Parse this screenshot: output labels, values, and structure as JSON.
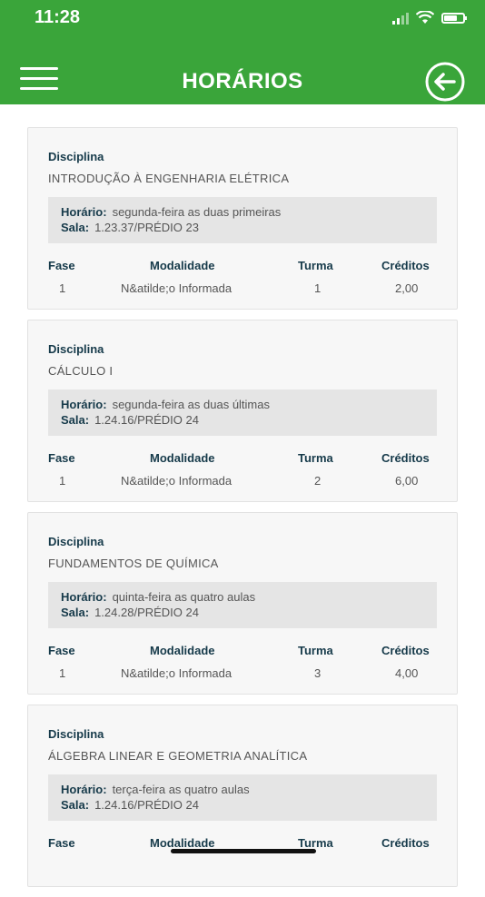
{
  "status": {
    "time": "11:28"
  },
  "header": {
    "title": "HORÁRIOS"
  },
  "labels": {
    "disciplina": "Disciplina",
    "horario": "Horário:",
    "sala": "Sala:",
    "fase": "Fase",
    "modalidade": "Modalidade",
    "turma": "Turma",
    "creditos": "Créditos"
  },
  "courses": [
    {
      "name": "INTRODUÇÃO À ENGENHARIA ELÉTRICA",
      "horario": "segunda-feira as duas primeiras",
      "sala": "1.23.37/PRÉDIO 23",
      "fase": "1",
      "modalidade": "N&atilde;o Informada",
      "turma": "1",
      "creditos": "2,00"
    },
    {
      "name": "CÁLCULO I",
      "horario": "segunda-feira as duas últimas",
      "sala": "1.24.16/PRÉDIO 24",
      "fase": "1",
      "modalidade": "N&atilde;o Informada",
      "turma": "2",
      "creditos": "6,00"
    },
    {
      "name": "FUNDAMENTOS DE QUÍMICA",
      "horario": "quinta-feira as quatro aulas",
      "sala": "1.24.28/PRÉDIO 24",
      "fase": "1",
      "modalidade": "N&atilde;o Informada",
      "turma": "3",
      "creditos": "4,00"
    },
    {
      "name": "ÁLGEBRA LINEAR E GEOMETRIA ANALÍTICA",
      "horario": "terça-feira as quatro aulas",
      "sala": "1.24.16/PRÉDIO 24"
    }
  ],
  "colors": {
    "header_green": "#3aa53a",
    "label_dark": "#163a4a"
  }
}
